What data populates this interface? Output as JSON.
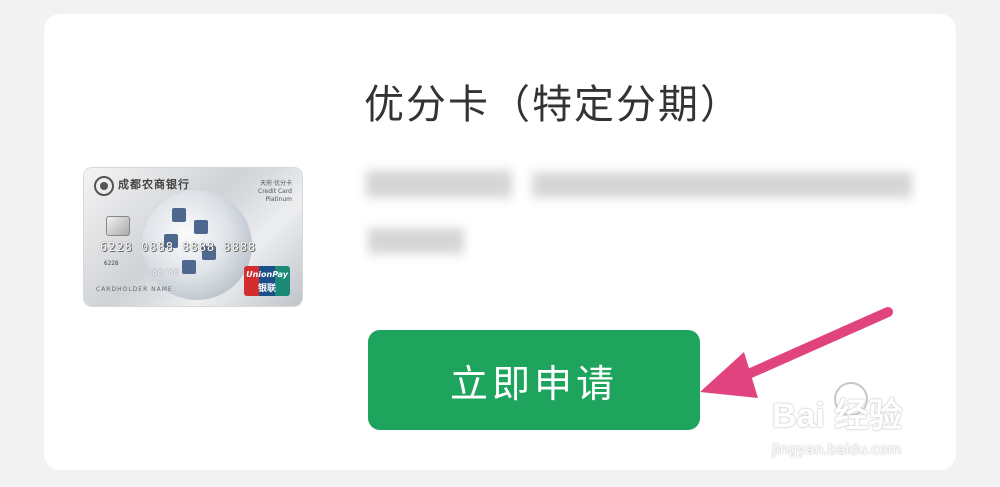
{
  "product": {
    "title": "优分卡（特定分期）"
  },
  "card": {
    "bank_name": "成都农商银行",
    "sub_label": "天府·优分卡",
    "credit_label": "Credit Card",
    "tier": "Platinum",
    "number": "6228 0888 8888 8888",
    "number_prefix": "6228",
    "valid_thru": "88/88",
    "holder": "CARDHOLDER NAME",
    "network_en": "UnionPay",
    "network_cn": "银联"
  },
  "actions": {
    "apply_label": "立即申请"
  },
  "annotation": {
    "arrow_color": "#e0437e"
  },
  "watermark": {
    "brand": "Bai  经验",
    "url": "jingyan.baidu.com"
  },
  "colors": {
    "apply_button": "#1fa45e",
    "title_text": "#333333",
    "background": "#f2f2f2"
  }
}
